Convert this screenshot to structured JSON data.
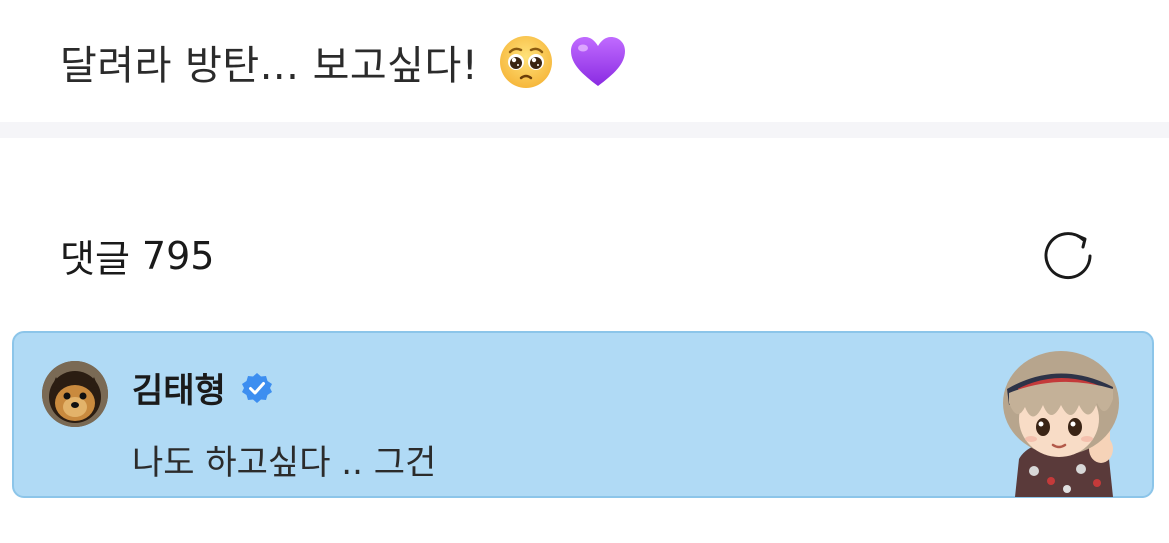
{
  "post": {
    "text": "달려라 방탄... 보고싶다!",
    "emojis": [
      "pleading-face-emoji",
      "purple-heart-emoji"
    ]
  },
  "comments": {
    "label": "댓글",
    "count": "795",
    "refresh_icon": "refresh-icon"
  },
  "comment": {
    "author": "김태형",
    "verified_icon": "verified-badge-icon",
    "text": "나도 하고싶다 .. 그건",
    "avatar": "dog-avatar",
    "sticker": "character-sticker"
  },
  "colors": {
    "card_bg": "#b0daf5",
    "card_border": "#8cc5e9",
    "verified": "#3d8ef0",
    "divider": "#f5f5f8"
  }
}
